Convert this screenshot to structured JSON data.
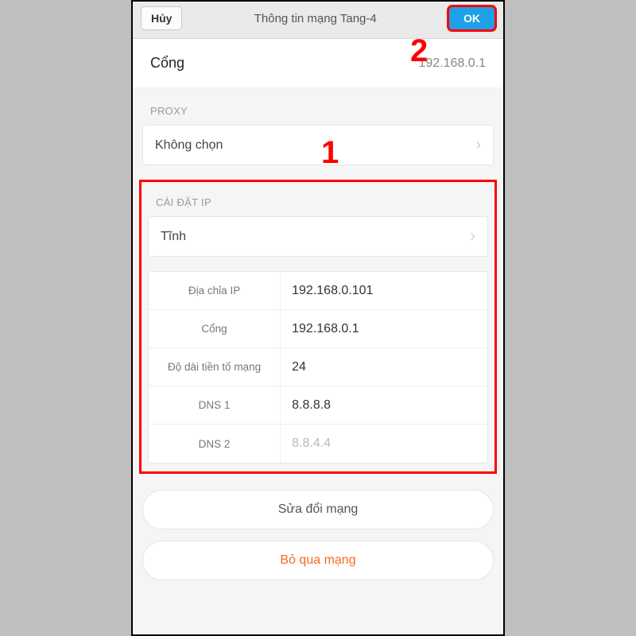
{
  "header": {
    "cancel_label": "Hủy",
    "title": "Thông tin mạng Tang-4",
    "ok_label": "OK"
  },
  "gateway": {
    "label": "Cổng",
    "value": "192.168.0.1"
  },
  "proxy": {
    "section_label": "PROXY",
    "selected": "Không chọn"
  },
  "ip_settings": {
    "section_label": "CÀI ĐẶT IP",
    "mode": "Tĩnh",
    "rows": [
      {
        "label": "Địa chỉa IP",
        "value": "192.168.0.101",
        "faded": false
      },
      {
        "label": "Cổng",
        "value": "192.168.0.1",
        "faded": false
      },
      {
        "label": "Độ dài tiền tố mạng",
        "value": "24",
        "faded": false
      },
      {
        "label": "DNS 1",
        "value": "8.8.8.8",
        "faded": false
      },
      {
        "label": "DNS 2",
        "value": "8.8.4.4",
        "faded": true
      }
    ]
  },
  "actions": {
    "modify": "Sửa đổi mạng",
    "forget": "Bỏ qua mạng"
  },
  "annotations": {
    "n1": "1",
    "n2": "2"
  }
}
